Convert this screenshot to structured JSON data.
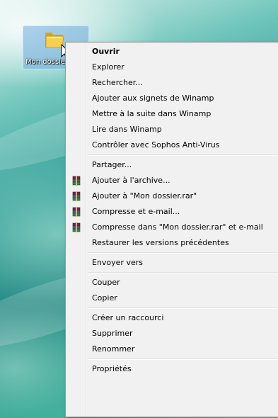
{
  "desktop": {
    "icon_label": "Mon dossier",
    "icon_name": "folder-icon"
  },
  "context_menu": {
    "items": [
      {
        "label": "Ouvrir",
        "bold": true,
        "icon": null
      },
      {
        "label": "Explorer",
        "icon": null
      },
      {
        "label": "Rechercher...",
        "icon": null
      },
      {
        "label": "Ajouter aux signets de Winamp",
        "icon": null
      },
      {
        "label": "Mettre à la suite dans Winamp",
        "icon": null
      },
      {
        "label": "Lire dans Winamp",
        "icon": null
      },
      {
        "label": "Contrôler avec Sophos Anti-Virus",
        "icon": null
      },
      {
        "label": "Partager...",
        "icon": null
      },
      {
        "label": "Ajouter à l'archive...",
        "icon": "winrar-icon"
      },
      {
        "label": "Ajouter à \"Mon dossier.rar\"",
        "icon": "winrar-icon"
      },
      {
        "label": "Compresse et e-mail...",
        "icon": "winrar-icon"
      },
      {
        "label": "Compresse dans \"Mon dossier.rar\" et e-mail",
        "icon": "winrar-icon"
      },
      {
        "label": "Restaurer les versions précédentes",
        "icon": null
      },
      {
        "label": "Envoyer vers",
        "icon": null
      },
      {
        "label": "Couper",
        "icon": null
      },
      {
        "label": "Copier",
        "icon": null
      },
      {
        "label": "Créer un raccourci",
        "icon": null
      },
      {
        "label": "Supprimer",
        "icon": null
      },
      {
        "label": "Renommer",
        "icon": null
      },
      {
        "label": "Propriétés",
        "icon": null
      }
    ]
  }
}
